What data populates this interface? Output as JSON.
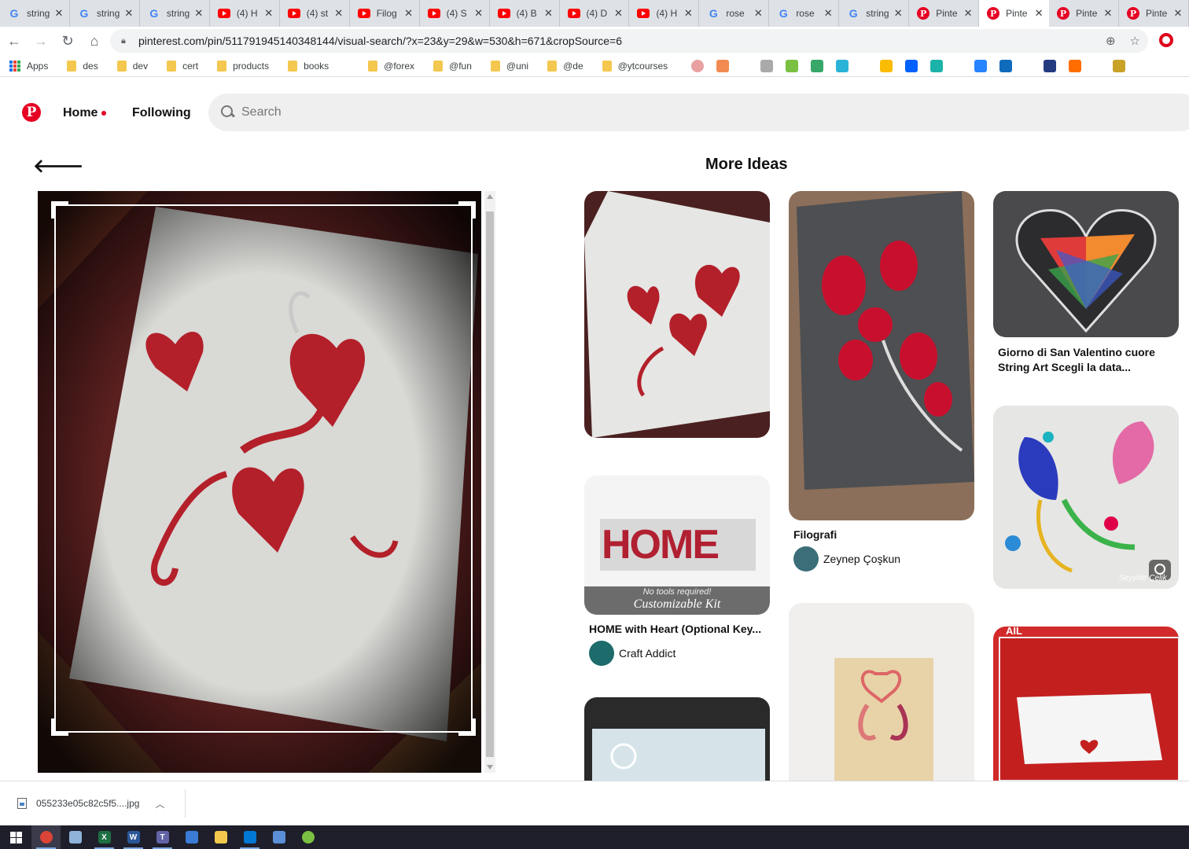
{
  "browser": {
    "tabs": [
      {
        "favicon": "google",
        "title": "string"
      },
      {
        "favicon": "google",
        "title": "string"
      },
      {
        "favicon": "google",
        "title": "string"
      },
      {
        "favicon": "youtube",
        "title": "(4) H"
      },
      {
        "favicon": "youtube",
        "title": "(4) st"
      },
      {
        "favicon": "youtube",
        "title": "Filog"
      },
      {
        "favicon": "youtube",
        "title": "(4) S"
      },
      {
        "favicon": "youtube",
        "title": "(4) B"
      },
      {
        "favicon": "youtube",
        "title": "(4) D"
      },
      {
        "favicon": "youtube",
        "title": "(4) H"
      },
      {
        "favicon": "google",
        "title": "rose"
      },
      {
        "favicon": "google",
        "title": "rose"
      },
      {
        "favicon": "google",
        "title": "string"
      },
      {
        "favicon": "pinterest",
        "title": "Pinte"
      },
      {
        "favicon": "pinterest",
        "title": "Pinte",
        "active": true
      },
      {
        "favicon": "pinterest",
        "title": "Pinte"
      },
      {
        "favicon": "pinterest",
        "title": "Pinte"
      }
    ],
    "close_glyph": "✕",
    "url": "pinterest.com/pin/511791945140348144/visual-search/?x=23&y=29&w=530&h=671&cropSource=6",
    "bookmarks": [
      "des",
      "dev",
      "cert",
      "products",
      "books",
      "@forex",
      "@fun",
      "@uni",
      "@de",
      "@ytcourses"
    ],
    "apps_label": "Apps"
  },
  "pinterest": {
    "nav": {
      "home": "Home",
      "following": "Following"
    },
    "search_placeholder": "Search",
    "section_title": "More Ideas",
    "pins": {
      "valentine_heart": {
        "title": "Giorno di San Valentino cuore String Art Scegli la data..."
      },
      "filografi": {
        "title": "Filografi",
        "author": "Zeynep Çoşkun"
      },
      "home_kit": {
        "title": "HOME with Heart (Optional Key...",
        "author": "Craft Addict",
        "image_text_word": "HOME",
        "image_caption_small": "No tools required!",
        "image_caption_large": "Customizable Kit"
      },
      "colorful_flower": {
        "watermark": "Seyyide Çelik"
      },
      "nebraska": {
        "image_text": "AIL"
      }
    }
  },
  "downloads": {
    "file_name": "055233e05c82c5f5....jpg"
  },
  "colors": {
    "brand": "#e60023",
    "heart_red": "#c8102e"
  }
}
